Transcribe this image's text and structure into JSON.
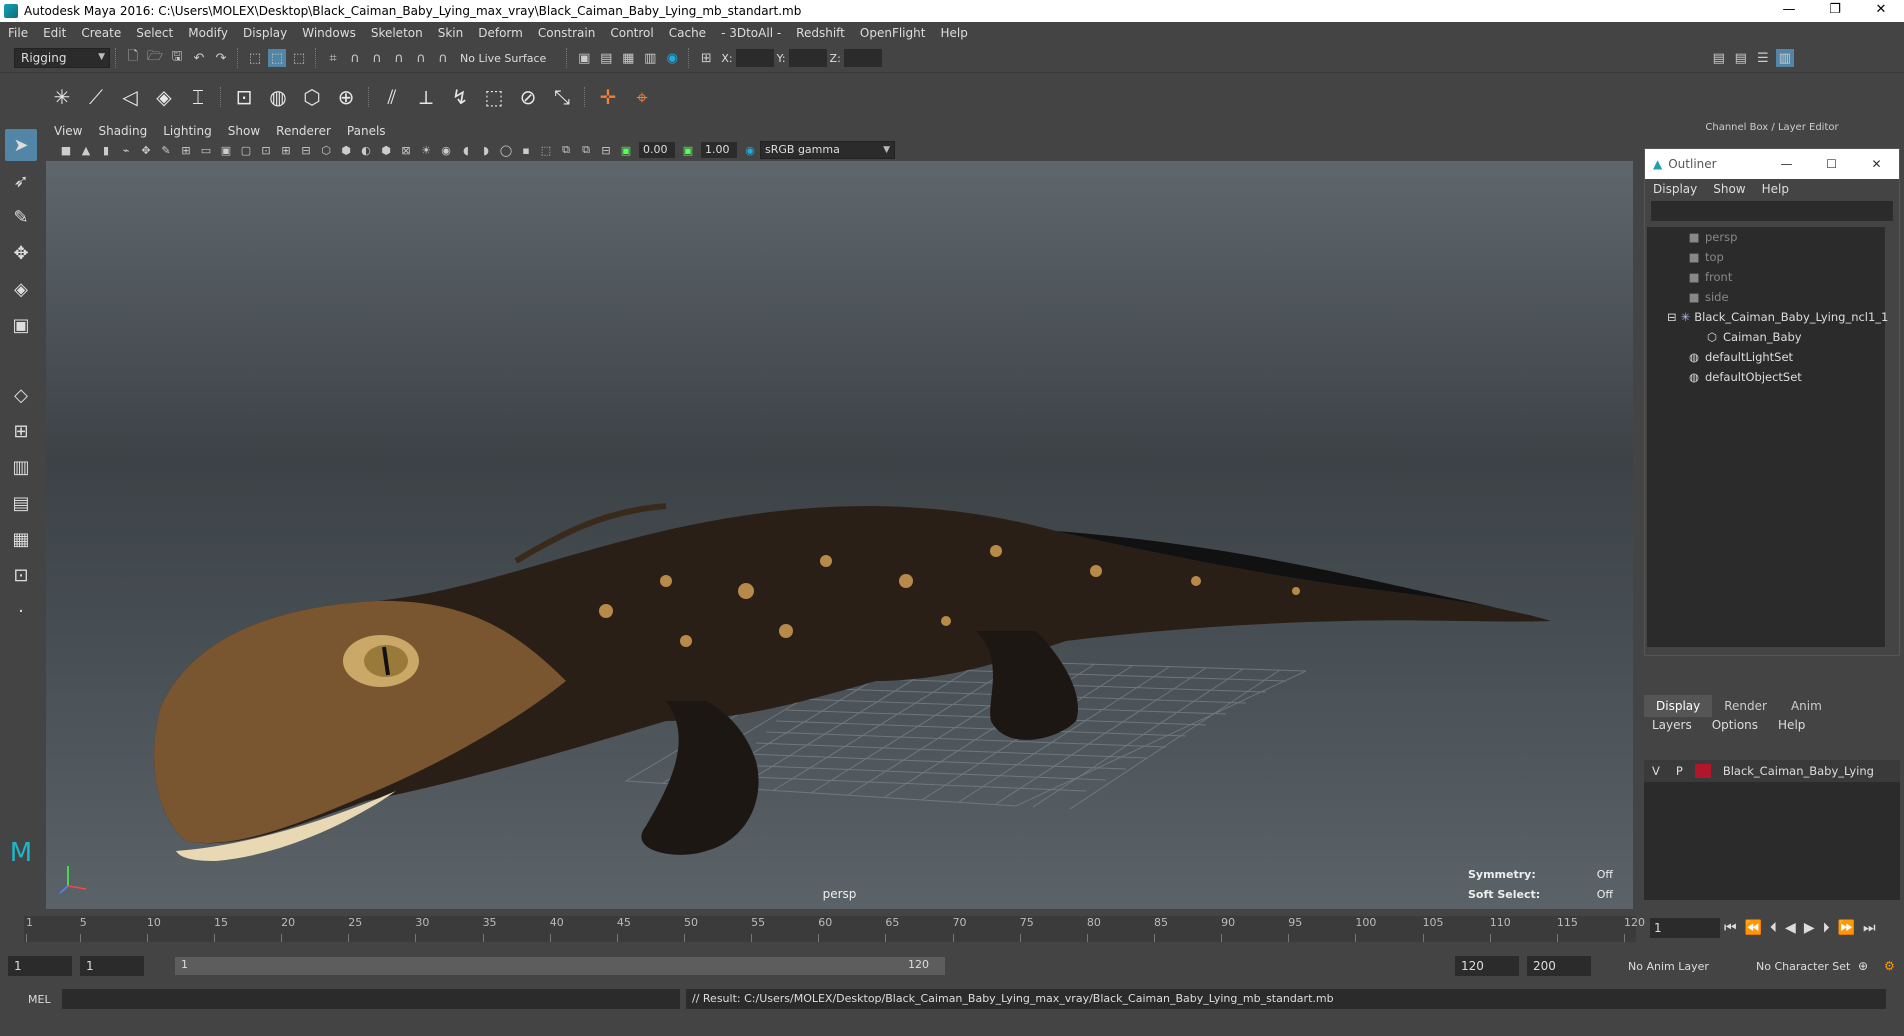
{
  "window": {
    "title": "Autodesk Maya 2016: C:\\Users\\MOLEX\\Desktop\\Black_Caiman_Baby_Lying_max_vray\\Black_Caiman_Baby_Lying_mb_standart.mb",
    "minimize": "—",
    "restore": "❐",
    "close": "✕"
  },
  "menubar": [
    "File",
    "Edit",
    "Create",
    "Select",
    "Modify",
    "Display",
    "Windows",
    "Skeleton",
    "Skin",
    "Deform",
    "Constrain",
    "Control",
    "Cache",
    "- 3DtoAll -",
    "Redshift",
    "OpenFlight",
    "Help"
  ],
  "statusline": {
    "menuset": "Rigging",
    "live_surface": "No Live Surface",
    "x_label": "X:",
    "y_label": "Y:",
    "z_label": "Z:"
  },
  "viewport": {
    "menu": [
      "View",
      "Shading",
      "Lighting",
      "Show",
      "Renderer",
      "Panels"
    ],
    "exposure": "0.00",
    "gamma": "1.00",
    "color_space": "sRGB gamma",
    "camera": "persp",
    "symmetry_label": "Symmetry:",
    "symmetry_value": "Off",
    "soft_select_label": "Soft Select:",
    "soft_select_value": "Off"
  },
  "channel_box": {
    "title": "Channel Box / Layer Editor"
  },
  "outliner": {
    "title": "Outliner",
    "menu": [
      "Display",
      "Show",
      "Help"
    ],
    "items": [
      {
        "label": "persp",
        "icon": "camera-icon"
      },
      {
        "label": "top",
        "icon": "camera-icon"
      },
      {
        "label": "front",
        "icon": "camera-icon"
      },
      {
        "label": "side",
        "icon": "camera-icon"
      },
      {
        "label": "Black_Caiman_Baby_Lying_ncl1_1",
        "icon": "joint-icon"
      },
      {
        "label": "Caiman_Baby",
        "icon": "mesh-icon"
      },
      {
        "label": "defaultLightSet",
        "icon": "set-icon"
      },
      {
        "label": "defaultObjectSet",
        "icon": "set-icon"
      }
    ]
  },
  "layer_editor": {
    "tabs": [
      "Display",
      "Render",
      "Anim"
    ],
    "menu": [
      "Layers",
      "Options",
      "Help"
    ],
    "layer": {
      "v": "V",
      "p": "P",
      "name": "Black_Caiman_Baby_Lying",
      "color": "#b1162a"
    }
  },
  "timeline": {
    "ticks": [
      "1",
      "5",
      "10",
      "15",
      "20",
      "25",
      "30",
      "35",
      "40",
      "45",
      "50",
      "55",
      "60",
      "65",
      "70",
      "75",
      "80",
      "85",
      "90",
      "95",
      "100",
      "105",
      "110",
      "115",
      "120"
    ],
    "current_frame": "1"
  },
  "range": {
    "start": "1",
    "anim_start": "1",
    "range_left": "1",
    "range_right": "120",
    "end": "120",
    "anim_end": "200",
    "anim_layer": "No Anim Layer",
    "char_set": "No Character Set"
  },
  "command_line": {
    "mode": "MEL",
    "result": "// Result: C:/Users/MOLEX/Desktop/Black_Caiman_Baby_Lying_max_vray/Black_Caiman_Baby_Lying_mb_standart.mb"
  }
}
